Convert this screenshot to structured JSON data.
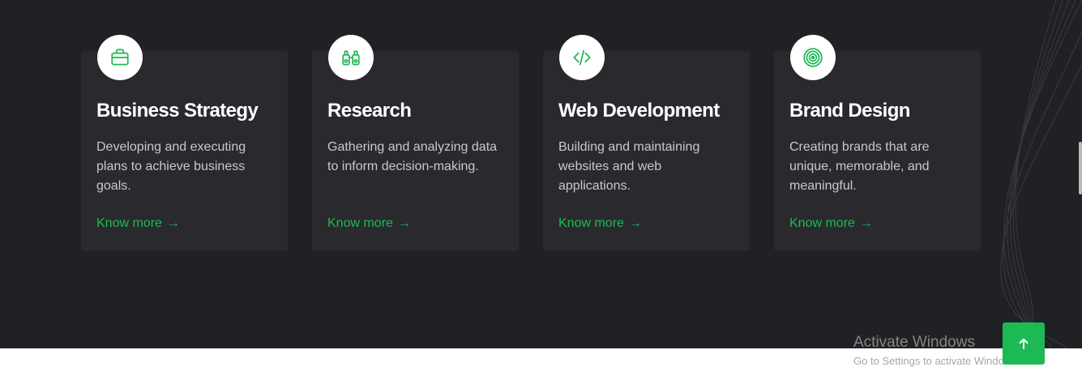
{
  "services": [
    {
      "title": "Business Strategy",
      "description": "Developing and executing plans to achieve business goals.",
      "link_label": "Know more",
      "icon": "briefcase-icon"
    },
    {
      "title": "Research",
      "description": "Gathering and analyzing data to inform decision-making.",
      "link_label": "Know more",
      "icon": "binoculars-icon"
    },
    {
      "title": "Web Development",
      "description": "Building and maintaining websites and web applications.",
      "link_label": "Know more",
      "icon": "code-icon"
    },
    {
      "title": "Brand Design",
      "description": "Creating brands that are unique, memorable, and meaningful.",
      "link_label": "Know more",
      "icon": "target-icon"
    }
  ],
  "watermark": {
    "title": "Activate Windows",
    "subtitle": "Go to Settings to activate Windows."
  },
  "back_to_top": {
    "icon": "arrow-up-icon"
  },
  "colors": {
    "background": "#202124",
    "card": "#2a2a2e",
    "accent": "#1db954",
    "text": "#ffffff",
    "muted_text": "#c9c9cd"
  }
}
